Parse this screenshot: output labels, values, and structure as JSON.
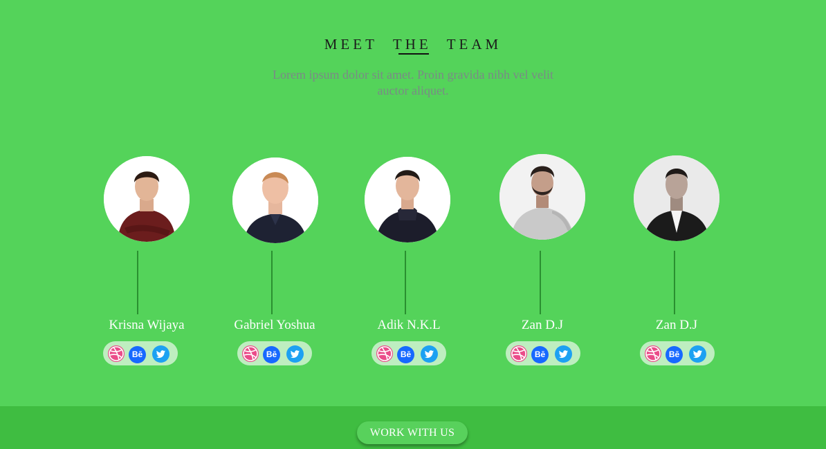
{
  "header": {
    "title_words": [
      "MEET",
      "THE",
      "TEAM"
    ],
    "subtitle": "Lorem ipsum dolor sit amet. Proin gravida nibh vel velit auctor aliquet."
  },
  "team": [
    {
      "name": "Krisna Wijaya",
      "socials": [
        "dribbble-icon",
        "behance-icon",
        "twitter-icon"
      ]
    },
    {
      "name": "Gabriel Yoshua",
      "socials": [
        "dribbble-icon",
        "behance-icon",
        "twitter-icon"
      ]
    },
    {
      "name": "Adik N.K.L",
      "socials": [
        "dribbble-icon",
        "behance-icon",
        "twitter-icon"
      ]
    },
    {
      "name": "Zan D.J",
      "socials": [
        "dribbble-icon",
        "behance-icon",
        "twitter-icon"
      ]
    },
    {
      "name": "Zan D.J",
      "socials": [
        "dribbble-icon",
        "behance-icon",
        "twitter-icon"
      ]
    }
  ],
  "social_labels": {
    "behance": "Bē"
  },
  "footer": {
    "cta_label": "WORK WITH US"
  },
  "colors": {
    "background": "#54d35a",
    "footer": "#3fbd41",
    "dribbble": "#ea4c89",
    "behance": "#1769ff",
    "twitter": "#1da1f2"
  }
}
